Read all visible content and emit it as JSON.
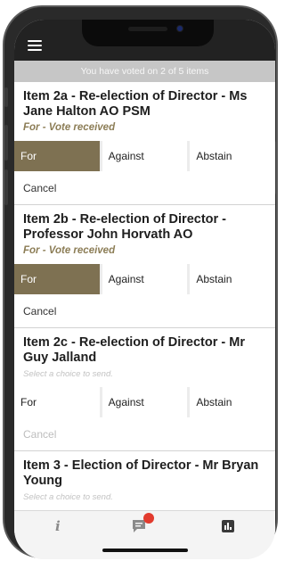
{
  "status_bar": {
    "time": "",
    "icons": ""
  },
  "banner": "You have voted on 2 of 5 items",
  "items": [
    {
      "title": "Item 2a - Re-election of Director - Ms Jane Halton AO PSM",
      "status": "For - Vote received",
      "choices": [
        "For",
        "Against",
        "Abstain"
      ],
      "selected": "For",
      "cancel": "Cancel"
    },
    {
      "title": "Item 2b - Re-election of Director - Professor John Horvath AO",
      "status": "For - Vote received",
      "choices": [
        "For",
        "Against",
        "Abstain"
      ],
      "selected": "For",
      "cancel": "Cancel"
    },
    {
      "title": "Item 2c - Re-election of Director - Mr Guy Jalland",
      "status": "Select a choice to send.",
      "choices": [
        "For",
        "Against",
        "Abstain"
      ],
      "selected": null,
      "cancel": "Cancel"
    },
    {
      "title": "Item 3 - Election of Director - Mr Bryan Young",
      "status": "Select a choice to send."
    }
  ],
  "tabbar": {
    "info_icon": "info-icon",
    "chat_icon": "chat-icon",
    "chart_icon": "chart-icon",
    "info_glyph": "i",
    "chat_has_notification": true
  },
  "colors": {
    "selected_choice": "#7e7152",
    "vote_received_text": "#8c7d56",
    "banner_bg": "#c6c6c6",
    "notification_badge": "#e23b2e"
  }
}
